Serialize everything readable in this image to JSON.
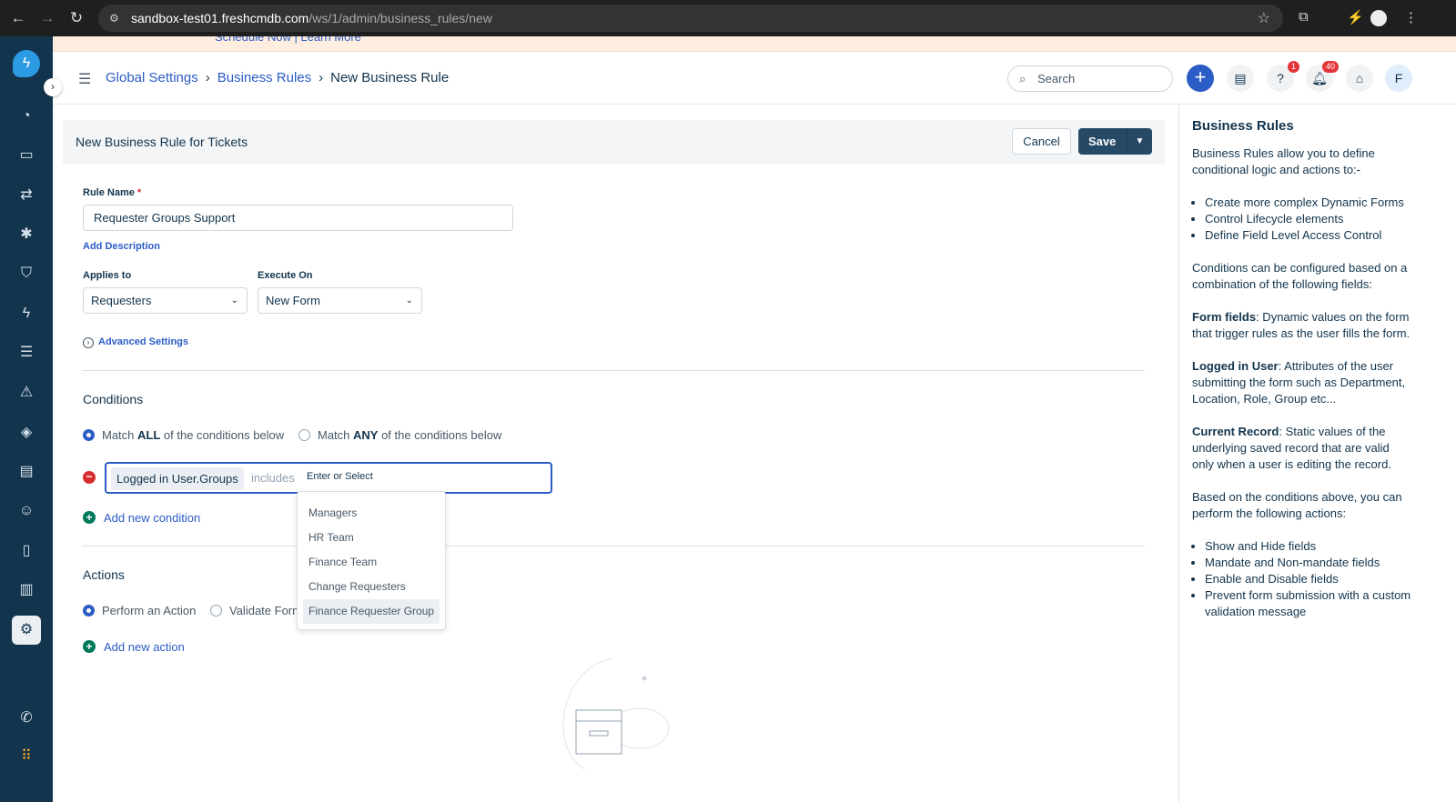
{
  "browser": {
    "url_host": "sandbox-test01.freshcmdb.com",
    "url_path": "/ws/1/admin/business_rules/new"
  },
  "banner": {
    "text": "Schedule Now | Learn More"
  },
  "header": {
    "breadcrumb": [
      "Global Settings",
      "Business Rules",
      "New Business Rule"
    ],
    "search_placeholder": "Search",
    "help_badge": "1",
    "notifications_badge": "40",
    "avatar_initial": "F"
  },
  "form": {
    "title": "New Business Rule for Tickets",
    "cancel": "Cancel",
    "save": "Save",
    "rule_name_label": "Rule Name",
    "rule_name_required": "*",
    "rule_name_value": "Requester Groups Support",
    "add_description": "Add Description",
    "applies_to_label": "Applies to",
    "applies_to_value": "Requesters",
    "execute_on_label": "Execute On",
    "execute_on_value": "New Form",
    "advanced_settings": "Advanced Settings",
    "conditions_title": "Conditions",
    "match_all_pre": "Match ",
    "match_all_bold": "ALL",
    "match_all_post": " of the conditions below",
    "match_any_pre": "Match ",
    "match_any_bold": "ANY",
    "match_any_post": " of the conditions below",
    "match_selected": "all",
    "condition": {
      "field": "Logged in User.Groups",
      "operator": "includes",
      "placeholder": "Enter or Select"
    },
    "add_condition": "Add new condition",
    "dropdown_options": [
      "Managers",
      "HR Team",
      "Finance Team",
      "Change Requesters",
      "Finance Requester Group"
    ],
    "dropdown_highlighted": "Finance Requester Group",
    "actions_title": "Actions",
    "perform_action": "Perform an Action",
    "validate_form": "Validate Form",
    "action_selected": "perform",
    "add_action": "Add new action"
  },
  "help": {
    "title": "Business Rules",
    "intro": "Business Rules allow you to define conditional logic and actions to:-",
    "list1": [
      "Create more complex Dynamic Forms",
      "Control Lifecycle elements",
      "Define Field Level Access Control"
    ],
    "p2": "Conditions can be configured based on a combination of the following fields:",
    "form_fields_title": "Form fields",
    "form_fields_text": ": Dynamic values on the form that trigger rules as the user fills the form.",
    "logged_title": "Logged in User",
    "logged_text": ": Attributes of the user submitting the form such as Department, Location, Role, Group etc...",
    "current_title": "Current Record",
    "current_text": ": Static values of the underlying saved record that are valid only when a user is editing the record.",
    "p3": "Based on the conditions above, you can perform the following actions:",
    "list2": [
      "Show and Hide fields",
      "Mandate and Non-mandate fields",
      "Enable and Disable fields",
      "Prevent form submission with a custom validation message"
    ]
  },
  "colors": {
    "sidebar": "#12344d",
    "primary": "#2c5cc5",
    "save": "#264966",
    "danger": "#d72d30",
    "success": "#00795b"
  }
}
